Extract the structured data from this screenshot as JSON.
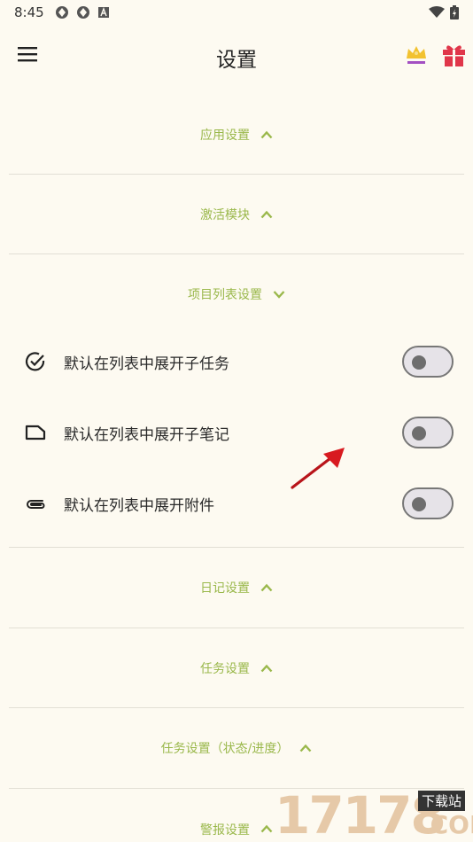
{
  "status_bar": {
    "time": "8:45"
  },
  "header": {
    "title": "设置"
  },
  "sections": {
    "app_settings": "应用设置",
    "activate_modules": "激活模块",
    "project_list": "项目列表设置",
    "diary": "日记设置",
    "task": "任务设置",
    "task_status": "任务设置（状态/进度）",
    "alert": "警报设置"
  },
  "settings": [
    {
      "label": "默认在列表中展开子任务",
      "icon": "check-circle-icon",
      "enabled": false
    },
    {
      "label": "默认在列表中展开子笔记",
      "icon": "note-icon",
      "enabled": false
    },
    {
      "label": "默认在列表中展开附件",
      "icon": "paperclip-icon",
      "enabled": false
    }
  ],
  "watermark": {
    "digits": "17178",
    "tag": "下载站",
    "suffix": ".COM"
  },
  "colors": {
    "background": "#fdfaf1",
    "accent": "#9ab84b",
    "crown": "#f2c230",
    "gift": "#e0364a"
  }
}
